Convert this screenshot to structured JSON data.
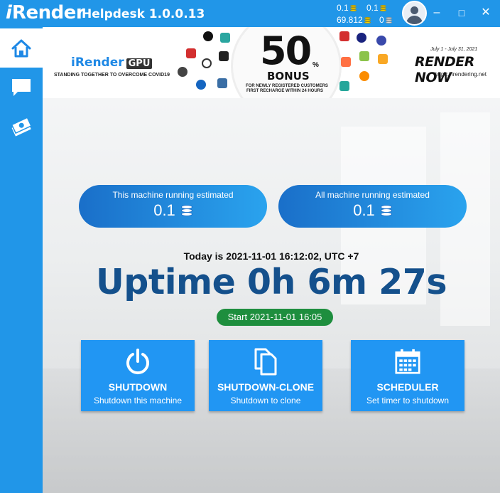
{
  "app": {
    "logo_i": "i",
    "logo_rest": "Render",
    "title": "Helpdesk 1.0.0.13"
  },
  "credits": {
    "top_left": "0.1",
    "top_right": "0.1",
    "bottom_left": "69.812",
    "bottom_right": "0"
  },
  "window": {
    "minimize": "–",
    "maximize": "□",
    "close": "✕"
  },
  "sidebar": [
    {
      "name": "home",
      "icon": "home-icon",
      "active": true
    },
    {
      "name": "chat",
      "icon": "chat-icon",
      "active": false
    },
    {
      "name": "payment",
      "icon": "money-icon",
      "active": false
    }
  ],
  "banner": {
    "brand": "iRender",
    "gpu": "GPU",
    "tagline": "STANDING TOGETHER TO OVERCOME COVID19",
    "big_number": "50",
    "pct": "%",
    "bonus": "BONUS",
    "sub1": "FOR NEWLY REGISTERED CUSTOMERS",
    "sub2": "FIRST RECHARGE WITHIN 24 HOURS",
    "dates": "July 1 - July 31, 2021",
    "cta": "RENDER NOW",
    "url": "https://irendering.net"
  },
  "estimates": {
    "this_label": "This machine running estimated",
    "this_value": "0.1",
    "all_label": "All machine running estimated",
    "all_value": "0.1"
  },
  "status": {
    "today": "Today is 2021-11-01 16:12:02, UTC +7",
    "uptime": "Uptime 0h 6m 27s",
    "start": "Start 2021-11-01 16:05"
  },
  "actions": [
    {
      "title": "SHUTDOWN",
      "subtitle": "Shutdown this machine",
      "icon": "power-icon"
    },
    {
      "title": "SHUTDOWN-CLONE",
      "subtitle": "Shutdown to clone",
      "icon": "copy-icon"
    },
    {
      "title": "SCHEDULER",
      "subtitle": "Set timer to shutdown",
      "icon": "calendar-icon"
    }
  ],
  "colors": {
    "primary": "#2196e8",
    "uptime_text": "#14508c",
    "start_badge": "#1e8e3e",
    "coin": "#ffd600"
  }
}
